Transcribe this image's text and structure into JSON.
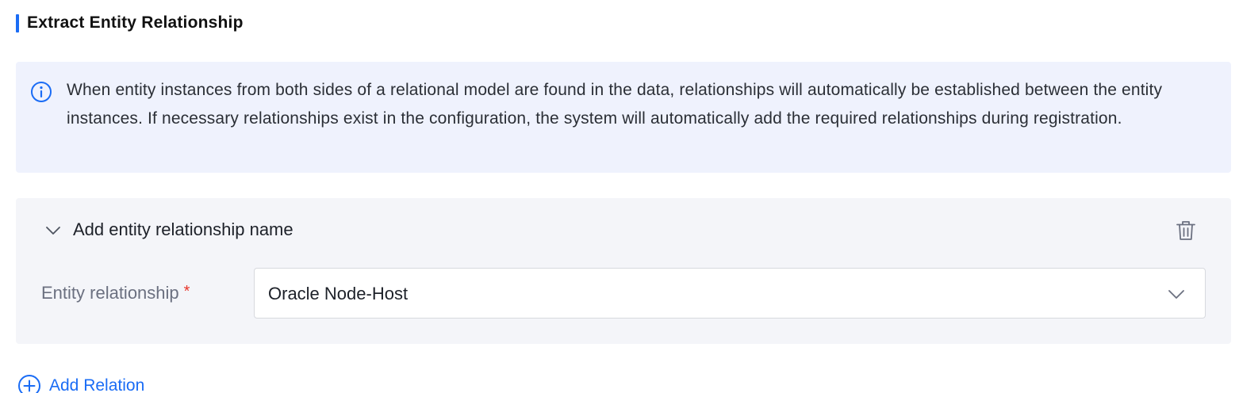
{
  "section": {
    "title": "Extract Entity Relationship"
  },
  "info": {
    "icon": "info-icon",
    "text": "When entity instances from both sides of a relational model are found in the data, relationships will automatically be established between the entity instances. If necessary relationships exist in the configuration, the system will automatically add the required relationships during registration."
  },
  "relation_card": {
    "title": "Add entity relationship name",
    "collapse_icon": "chevron-down-icon",
    "delete_icon": "trash-icon",
    "field": {
      "label": "Entity relationship",
      "required_mark": "*",
      "value": "Oracle Node-Host"
    }
  },
  "add_relation": {
    "label": "Add Relation",
    "icon": "plus-circle-icon"
  },
  "colors": {
    "accent": "#1a6cf5",
    "info_bg": "#eff2fd",
    "card_bg": "#f4f5f9",
    "required": "#e8362b"
  }
}
